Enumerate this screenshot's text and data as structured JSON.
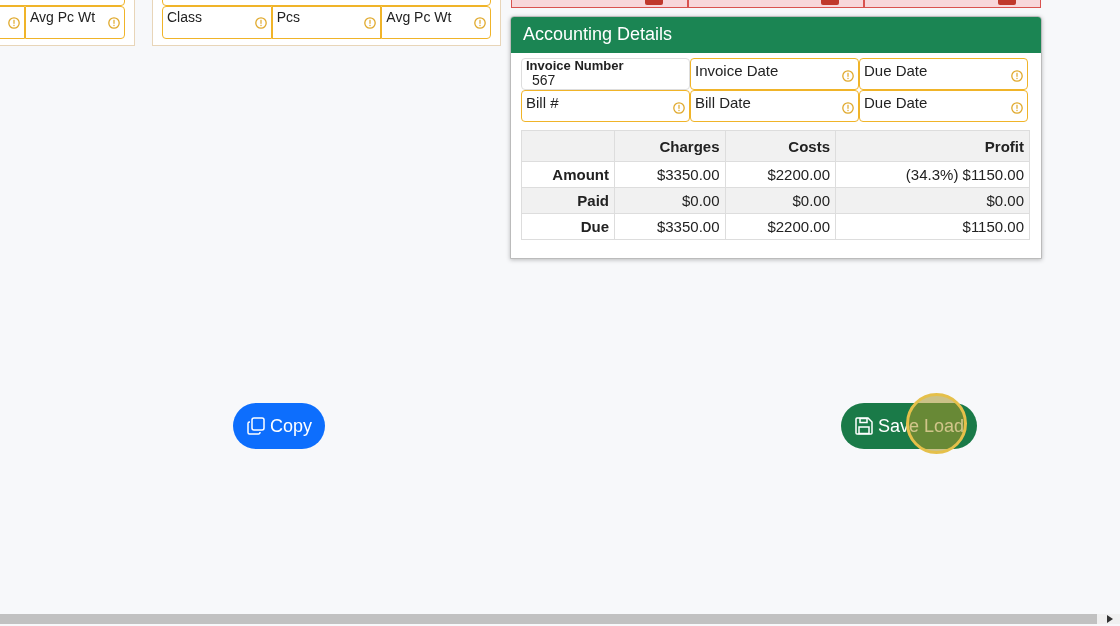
{
  "left_panel": {
    "fields": [
      {
        "warning": true
      },
      {
        "label": "Avg Pc Wt",
        "warning": true
      }
    ]
  },
  "middle_panel": {
    "fields": [
      {
        "label": "Class",
        "warning": true
      },
      {
        "label": "Pcs",
        "warning": true
      },
      {
        "label": "Avg Pc Wt",
        "warning": true
      }
    ]
  },
  "error_fields": [
    {
      "error": true
    },
    {
      "error": true
    },
    {
      "error": true
    }
  ],
  "accounting": {
    "title": "Accounting Details",
    "fields": [
      {
        "label": "Invoice Number",
        "value": "567",
        "warning": false
      },
      {
        "label": "Invoice Date",
        "warning": true
      },
      {
        "label": "Due Date",
        "warning": true
      },
      {
        "label": "Bill #",
        "warning": true
      },
      {
        "label": "Bill Date",
        "warning": true
      },
      {
        "label": "Due Date",
        "warning": true
      }
    ],
    "table": {
      "columns": [
        "Charges",
        "Costs",
        "Profit"
      ],
      "rows": [
        {
          "label": "Amount",
          "cells": [
            "$3350.00",
            "$2200.00",
            "(34.3%) $1150.00"
          ]
        },
        {
          "label": "Paid",
          "cells": [
            "$0.00",
            "$0.00",
            "$0.00"
          ]
        },
        {
          "label": "Due",
          "cells": [
            "$3350.00",
            "$2200.00",
            "$1150.00"
          ]
        }
      ]
    }
  },
  "buttons": [
    {
      "label": "Copy",
      "kind": "copy"
    },
    {
      "label": "Save Load",
      "kind": "save"
    }
  ],
  "cursor_highlight": true
}
